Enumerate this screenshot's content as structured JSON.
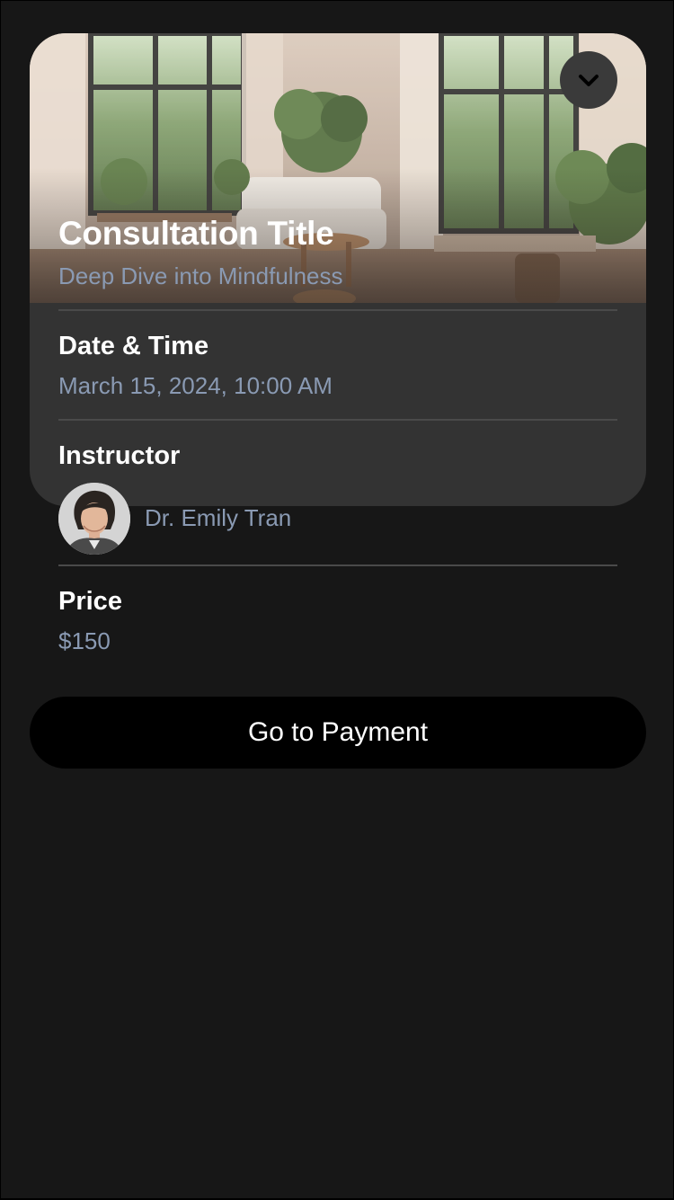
{
  "consultation": {
    "title": "Consultation Title",
    "subtitle": "Deep Dive into Mindfulness",
    "collapse_icon": "chevron-down-icon",
    "hero_image": "sunlit living room with plants and large windows"
  },
  "details": {
    "date_label": "Date & Time",
    "date_value": "March 15, 2024, 10:00 AM",
    "instructor_label": "Instructor",
    "instructor_name": "Dr. Emily Tran",
    "price_label": "Price",
    "price_value": "$150"
  },
  "actions": {
    "payment_label": "Go to Payment"
  },
  "colors": {
    "background": "#171717",
    "card": "#333333",
    "secondary_text": "#8a9ab3",
    "button": "#000000"
  }
}
